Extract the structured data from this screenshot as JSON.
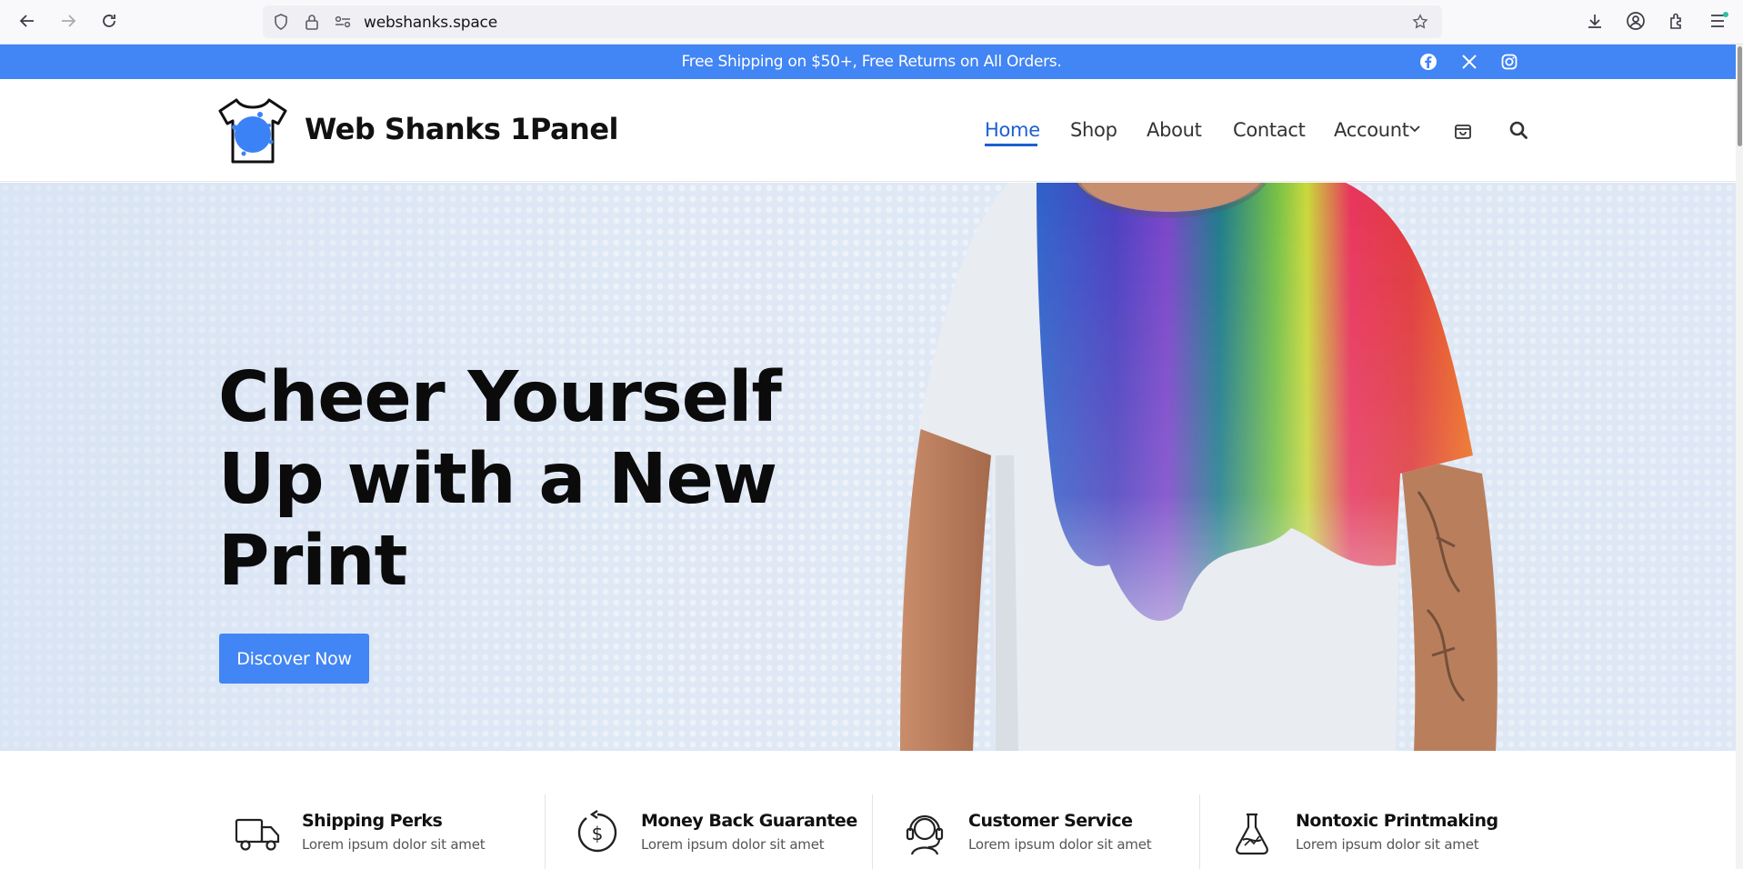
{
  "browser": {
    "url": "webshanks.space",
    "icons": [
      "back-icon",
      "forward-icon",
      "reload-icon",
      "shield-icon",
      "lock-icon",
      "site-info-icon",
      "bookmark-star-icon",
      "downloads-icon",
      "account-icon",
      "extensions-icon",
      "menu-icon"
    ]
  },
  "announcement": {
    "text": "Free Shipping on $50+, Free Returns on All Orders.",
    "social": [
      "facebook-icon",
      "x-icon",
      "instagram-icon"
    ]
  },
  "header": {
    "site_title": "Web Shanks 1Panel",
    "menu": [
      {
        "label": "Home",
        "active": true
      },
      {
        "label": "Shop"
      },
      {
        "label": "About"
      },
      {
        "label": "Contact"
      },
      {
        "label": "Account"
      }
    ]
  },
  "hero": {
    "title": "Cheer Yourself Up with a New Print",
    "button": "Discover Now"
  },
  "features": [
    {
      "icon": "truck-icon",
      "title": "Shipping Perks",
      "subtitle": "Lorem ipsum dolor sit amet"
    },
    {
      "icon": "money-back-icon",
      "title": "Money Back Guarantee",
      "subtitle": "Lorem ipsum dolor sit amet"
    },
    {
      "icon": "headset-icon",
      "title": "Customer Service",
      "subtitle": "Lorem ipsum dolor sit amet"
    },
    {
      "icon": "flask-icon",
      "title": "Nontoxic Printmaking",
      "subtitle": "Lorem ipsum dolor sit amet"
    }
  ],
  "colors": {
    "accent": "#4285f4",
    "menu_active": "#1d5fd1",
    "hero_bg": "#dfe8f5"
  }
}
